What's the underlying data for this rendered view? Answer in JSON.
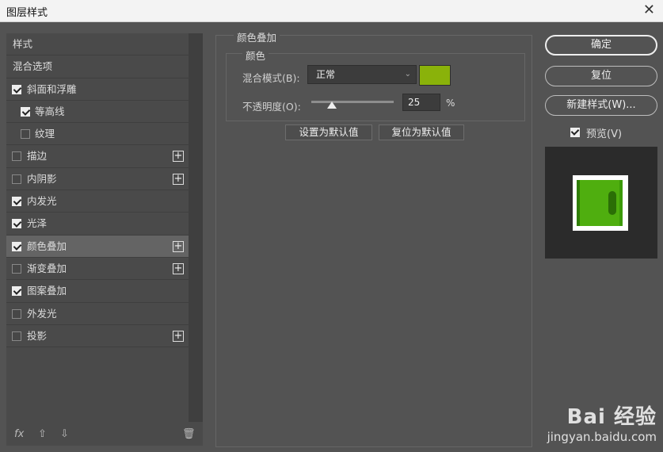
{
  "window": {
    "title": "图层样式",
    "close_glyph": "✕"
  },
  "sidebar": {
    "items": [
      {
        "label": "样式",
        "checkbox": false,
        "checked": false,
        "plus": false
      },
      {
        "label": "混合选项",
        "checkbox": false,
        "checked": false,
        "plus": false
      },
      {
        "label": "斜面和浮雕",
        "checkbox": true,
        "checked": true,
        "plus": false
      },
      {
        "label": "等高线",
        "checkbox": true,
        "checked": true,
        "plus": false,
        "indent": true
      },
      {
        "label": "纹理",
        "checkbox": true,
        "checked": false,
        "plus": false,
        "indent": true
      },
      {
        "label": "描边",
        "checkbox": true,
        "checked": false,
        "plus": true
      },
      {
        "label": "内阴影",
        "checkbox": true,
        "checked": false,
        "plus": true
      },
      {
        "label": "内发光",
        "checkbox": true,
        "checked": true,
        "plus": false
      },
      {
        "label": "光泽",
        "checkbox": true,
        "checked": true,
        "plus": false
      },
      {
        "label": "颜色叠加",
        "checkbox": true,
        "checked": true,
        "plus": true,
        "active": true
      },
      {
        "label": "渐变叠加",
        "checkbox": true,
        "checked": false,
        "plus": true
      },
      {
        "label": "图案叠加",
        "checkbox": true,
        "checked": true,
        "plus": false
      },
      {
        "label": "外发光",
        "checkbox": true,
        "checked": false,
        "plus": false
      },
      {
        "label": "投影",
        "checkbox": true,
        "checked": false,
        "plus": true
      }
    ],
    "plus_glyph": "+",
    "bottom": {
      "fx": "fx",
      "up": "⇧",
      "down": "⇩",
      "trash": "🗑"
    }
  },
  "color_overlay": {
    "section_title": "颜色叠加",
    "group_title": "颜色",
    "blend_mode_label": "混合模式(B):",
    "blend_mode_value": "正常",
    "blend_mode_arrow": "⌄",
    "swatch_color": "#8ab20a",
    "opacity_label": "不透明度(O):",
    "opacity_value": "25",
    "opacity_unit": "%",
    "opacity_fraction": 0.25,
    "set_default": "设置为默认值",
    "reset_default": "复位为默认值"
  },
  "actions": {
    "ok": "确定",
    "reset": "复位",
    "new_style": "新建样式(W)...",
    "preview_label": "预览(V)"
  },
  "watermark": {
    "brand": "Bai 经验",
    "url": "jingyan.baidu.com"
  }
}
